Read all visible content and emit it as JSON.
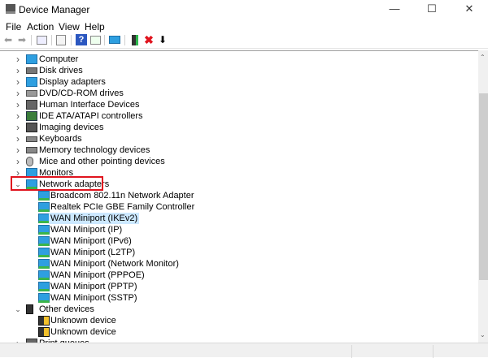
{
  "window": {
    "title": "Device Manager",
    "minimize": "—",
    "maximize": "☐",
    "close": "✕"
  },
  "menu": [
    "File",
    "Action",
    "View",
    "Help"
  ],
  "toolbar": [
    "back-icon",
    "forward-icon",
    "show-hide-console-tree-icon",
    "properties-icon",
    "help-icon",
    "action-pane-icon",
    "scan-hardware-icon",
    "update-driver-icon",
    "uninstall-icon",
    "disable-icon"
  ],
  "tree": [
    {
      "label": "Computer",
      "level": 0,
      "expanded": false,
      "icon": "computer"
    },
    {
      "label": "Disk drives",
      "level": 0,
      "expanded": false,
      "icon": "disk"
    },
    {
      "label": "Display adapters",
      "level": 0,
      "expanded": false,
      "icon": "monitor"
    },
    {
      "label": "DVD/CD-ROM drives",
      "level": 0,
      "expanded": false,
      "icon": "dvd"
    },
    {
      "label": "Human Interface Devices",
      "level": 0,
      "expanded": false,
      "icon": "hid"
    },
    {
      "label": "IDE ATA/ATAPI controllers",
      "level": 0,
      "expanded": false,
      "icon": "ide"
    },
    {
      "label": "Imaging devices",
      "level": 0,
      "expanded": false,
      "icon": "camera"
    },
    {
      "label": "Keyboards",
      "level": 0,
      "expanded": false,
      "icon": "keyboard"
    },
    {
      "label": "Memory technology devices",
      "level": 0,
      "expanded": false,
      "icon": "memory"
    },
    {
      "label": "Mice and other pointing devices",
      "level": 0,
      "expanded": false,
      "icon": "mouse"
    },
    {
      "label": "Monitors",
      "level": 0,
      "expanded": false,
      "icon": "monitor"
    },
    {
      "label": "Network adapters",
      "level": 0,
      "expanded": true,
      "icon": "network",
      "highlighted": true
    },
    {
      "label": "Broadcom 802.11n Network Adapter",
      "level": 1,
      "icon": "network"
    },
    {
      "label": "Realtek PCIe GBE Family Controller",
      "level": 1,
      "icon": "network"
    },
    {
      "label": "WAN Miniport (IKEv2)",
      "level": 1,
      "icon": "network",
      "selected": true
    },
    {
      "label": "WAN Miniport (IP)",
      "level": 1,
      "icon": "network"
    },
    {
      "label": "WAN Miniport (IPv6)",
      "level": 1,
      "icon": "network"
    },
    {
      "label": "WAN Miniport (L2TP)",
      "level": 1,
      "icon": "network"
    },
    {
      "label": "WAN Miniport (Network Monitor)",
      "level": 1,
      "icon": "network"
    },
    {
      "label": "WAN Miniport (PPPOE)",
      "level": 1,
      "icon": "network"
    },
    {
      "label": "WAN Miniport (PPTP)",
      "level": 1,
      "icon": "network"
    },
    {
      "label": "WAN Miniport (SSTP)",
      "level": 1,
      "icon": "network"
    },
    {
      "label": "Other devices",
      "level": 0,
      "expanded": true,
      "icon": "unknown"
    },
    {
      "label": "Unknown device",
      "level": 1,
      "icon": "warning"
    },
    {
      "label": "Unknown device",
      "level": 1,
      "icon": "warning"
    },
    {
      "label": "Print queues",
      "level": 0,
      "expanded": false,
      "icon": "printer"
    }
  ],
  "colors": {
    "highlight_box": "#e0141e",
    "selection": "#cce8ff",
    "accent": "#2e9fe0"
  }
}
